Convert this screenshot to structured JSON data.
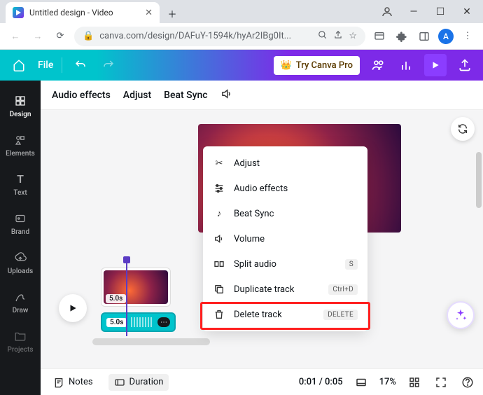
{
  "window": {
    "tab_title": "Untitled design - Video"
  },
  "addressbar": {
    "url": "canva.com/design/DAFuY-1594k/hyAr2IBg0It...",
    "avatar_letter": "A"
  },
  "appbar": {
    "file": "File",
    "try_pro": "Try Canva Pro"
  },
  "sidebar": {
    "items": [
      {
        "label": "Design"
      },
      {
        "label": "Elements"
      },
      {
        "label": "Text"
      },
      {
        "label": "Brand"
      },
      {
        "label": "Uploads"
      },
      {
        "label": "Draw"
      },
      {
        "label": "Projects"
      }
    ]
  },
  "toolbar": {
    "audio_effects": "Audio effects",
    "adjust": "Adjust",
    "beat_sync": "Beat Sync"
  },
  "context_menu": {
    "items": [
      {
        "label": "Adjust",
        "shortcut": ""
      },
      {
        "label": "Audio effects",
        "shortcut": ""
      },
      {
        "label": "Beat Sync",
        "shortcut": ""
      },
      {
        "label": "Volume",
        "shortcut": ""
      },
      {
        "label": "Split audio",
        "shortcut": "S"
      },
      {
        "label": "Duplicate track",
        "shortcut": "Ctrl+D"
      },
      {
        "label": "Delete track",
        "shortcut": "DELETE"
      }
    ]
  },
  "timeline": {
    "video_duration": "5.0s",
    "audio_duration": "5.0s"
  },
  "footer": {
    "notes": "Notes",
    "duration": "Duration",
    "time": "0:01 / 0:05",
    "zoom": "17%"
  }
}
